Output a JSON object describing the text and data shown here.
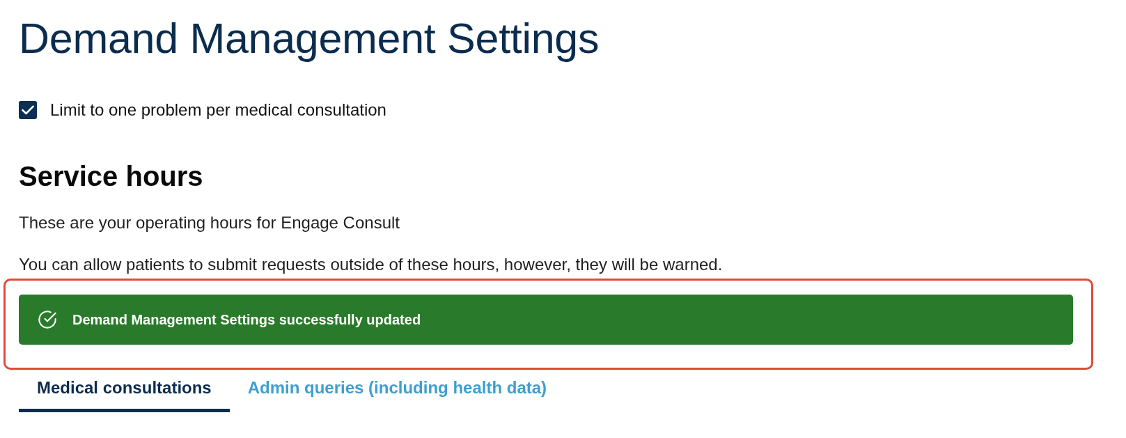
{
  "page": {
    "title": "Demand Management Settings"
  },
  "options": [
    {
      "label": "Limit to one problem per medical consultation",
      "checked": true
    }
  ],
  "service_hours": {
    "heading": "Service hours",
    "paragraphs": [
      "These are your operating hours for Engage Consult",
      "You can allow patients to submit requests outside of these hours, however, they will be warned."
    ]
  },
  "notification": {
    "kind": "success",
    "message": "Demand Management Settings successfully updated",
    "highlighted": true
  },
  "tabs": [
    {
      "label": "Medical consultations",
      "selected": true
    },
    {
      "label": "Admin queries (including health data)",
      "selected": false
    }
  ]
}
